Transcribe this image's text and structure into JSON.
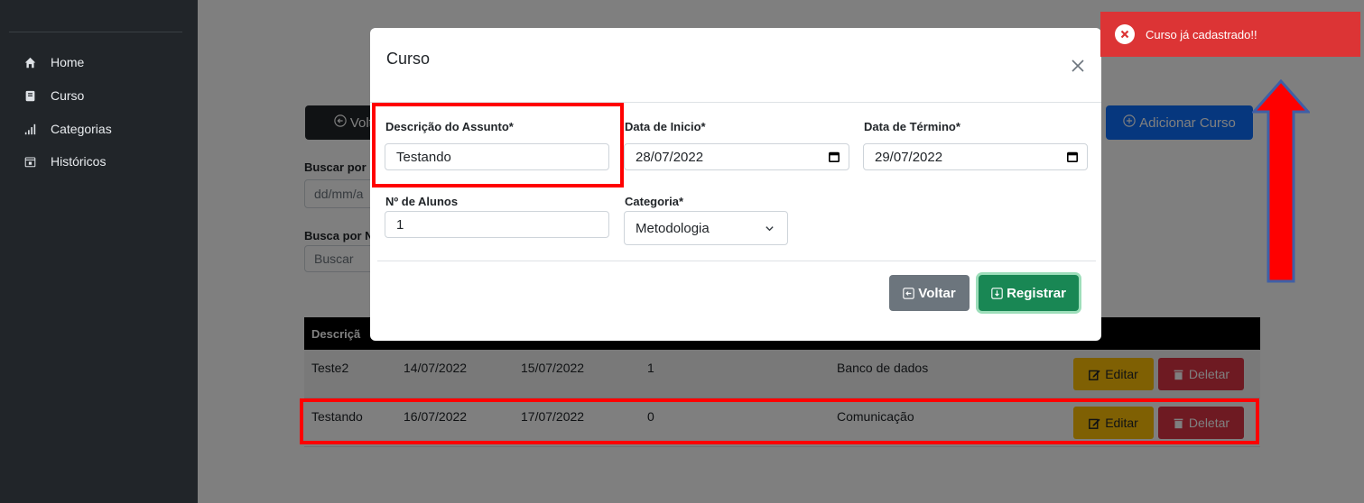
{
  "sidebar": {
    "items": [
      {
        "label": "Home",
        "icon": "home-icon"
      },
      {
        "label": "Curso",
        "icon": "book-icon"
      },
      {
        "label": "Categorias",
        "icon": "bar-chart-icon"
      },
      {
        "label": "Históricos",
        "icon": "calendar-icon"
      }
    ]
  },
  "page": {
    "back_label": "Voltar",
    "add_label": "Adicionar Curso",
    "search_date_label": "Buscar por",
    "search_date_placeholder": "dd/mm/a",
    "search_name_label": "Busca por N",
    "search_name_placeholder": "Buscar",
    "table_header_first": "Descriçã",
    "rows": [
      {
        "descricao": "Teste2",
        "inicio": "14/07/2022",
        "termino": "15/07/2022",
        "alunos": "1",
        "categoria": "Banco de dados"
      },
      {
        "descricao": "Testando",
        "inicio": "16/07/2022",
        "termino": "17/07/2022",
        "alunos": "0",
        "categoria": "Comunicação"
      }
    ],
    "edit_label": "Editar",
    "delete_label": "Deletar"
  },
  "modal": {
    "title": "Curso",
    "descricao_label": "Descrição do Assunto*",
    "descricao_value": "Testando",
    "inicio_label": "Data de Inicio*",
    "inicio_value": "28/07/2022",
    "termino_label": "Data de Término*",
    "termino_value": "29/07/2022",
    "alunos_label": "Nº de Alunos",
    "alunos_value": "1",
    "categoria_label": "Categoria*",
    "categoria_value": "Metodologia",
    "voltar_label": "Voltar",
    "registrar_label": "Registrar"
  },
  "toast": {
    "message": "Curso já cadastrado!!"
  },
  "colors": {
    "sidebar": "#212529",
    "primary": "#0d6efd",
    "success": "#198754",
    "secondary": "#6c757d",
    "warning": "#ffc107",
    "danger": "#dc3545",
    "toast": "#dc3435",
    "annotation": "#ff0000"
  }
}
